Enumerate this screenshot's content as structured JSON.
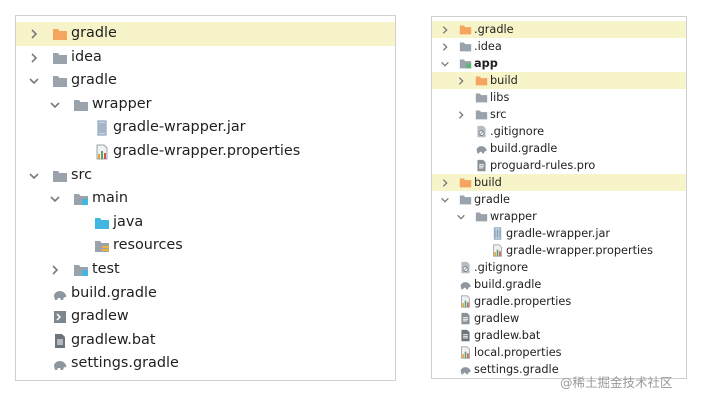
{
  "colors": {
    "folder_gray": "#9aa3ab",
    "folder_orange": "#f5a55f",
    "folder_blue": "#40b6e0",
    "selection": "#f6f4c8"
  },
  "left_tree": [
    {
      "label": "gradle",
      "level": 0,
      "expander": "right",
      "icon": "orange-folder-icon",
      "selected": true
    },
    {
      "label": "idea",
      "level": 0,
      "expander": "right",
      "icon": "folder-icon"
    },
    {
      "label": "gradle",
      "level": 0,
      "expander": "down",
      "icon": "folder-icon"
    },
    {
      "label": "wrapper",
      "level": 1,
      "expander": "down",
      "icon": "folder-icon"
    },
    {
      "label": "gradle-wrapper.jar",
      "level": 2,
      "expander": "none",
      "icon": "jar-file-icon"
    },
    {
      "label": "gradle-wrapper.properties",
      "level": 2,
      "expander": "none",
      "icon": "properties-file-icon"
    },
    {
      "label": "src",
      "level": 0,
      "expander": "down",
      "icon": "folder-icon"
    },
    {
      "label": "main",
      "level": 1,
      "expander": "down",
      "icon": "source-folder-icon"
    },
    {
      "label": "java",
      "level": 2,
      "expander": "none",
      "icon": "blue-folder-icon"
    },
    {
      "label": "resources",
      "level": 2,
      "expander": "none",
      "icon": "resources-folder-icon"
    },
    {
      "label": "test",
      "level": 1,
      "expander": "right",
      "icon": "source-folder-icon"
    },
    {
      "label": "build.gradle",
      "level": 0,
      "expander": "none",
      "icon": "gradle-elephant-icon"
    },
    {
      "label": "gradlew",
      "level": 0,
      "expander": "none",
      "icon": "shell-script-icon"
    },
    {
      "label": "gradlew.bat",
      "level": 0,
      "expander": "none",
      "icon": "batch-file-icon"
    },
    {
      "label": "settings.gradle",
      "level": 0,
      "expander": "none",
      "icon": "gradle-elephant-icon"
    }
  ],
  "right_tree": [
    {
      "label": ".gradle",
      "level": 0,
      "expander": "right",
      "icon": "orange-folder-icon",
      "selected": true
    },
    {
      "label": ".idea",
      "level": 0,
      "expander": "right",
      "icon": "folder-icon"
    },
    {
      "label": "app",
      "level": 0,
      "expander": "down",
      "icon": "module-folder-icon",
      "bold": true
    },
    {
      "label": "build",
      "level": 1,
      "expander": "right",
      "icon": "orange-folder-icon",
      "selected": true
    },
    {
      "label": "libs",
      "level": 1,
      "expander": "none",
      "icon": "folder-icon"
    },
    {
      "label": "src",
      "level": 1,
      "expander": "right",
      "icon": "folder-icon"
    },
    {
      "label": ".gitignore",
      "level": 1,
      "expander": "none",
      "icon": "gitignore-file-icon"
    },
    {
      "label": "build.gradle",
      "level": 1,
      "expander": "none",
      "icon": "gradle-elephant-icon"
    },
    {
      "label": "proguard-rules.pro",
      "level": 1,
      "expander": "none",
      "icon": "text-file-icon"
    },
    {
      "label": "build",
      "level": 0,
      "expander": "right",
      "icon": "orange-folder-icon",
      "selected": true
    },
    {
      "label": "gradle",
      "level": 0,
      "expander": "down",
      "icon": "folder-icon"
    },
    {
      "label": "wrapper",
      "level": 1,
      "expander": "down",
      "icon": "folder-icon"
    },
    {
      "label": "gradle-wrapper.jar",
      "level": 2,
      "expander": "none",
      "icon": "jar-file-icon"
    },
    {
      "label": "gradle-wrapper.properties",
      "level": 2,
      "expander": "none",
      "icon": "properties-file-icon"
    },
    {
      "label": ".gitignore",
      "level": 0,
      "expander": "none",
      "icon": "gitignore-file-icon"
    },
    {
      "label": "build.gradle",
      "level": 0,
      "expander": "none",
      "icon": "gradle-elephant-icon"
    },
    {
      "label": "gradle.properties",
      "level": 0,
      "expander": "none",
      "icon": "properties-file-icon"
    },
    {
      "label": "gradlew",
      "level": 0,
      "expander": "none",
      "icon": "text-file-icon"
    },
    {
      "label": "gradlew.bat",
      "level": 0,
      "expander": "none",
      "icon": "batch-file-icon"
    },
    {
      "label": "local.properties",
      "level": 0,
      "expander": "none",
      "icon": "properties-file-icon"
    },
    {
      "label": "settings.gradle",
      "level": 0,
      "expander": "none",
      "icon": "gradle-elephant-icon"
    }
  ],
  "watermark": "@稀土掘金技术社区"
}
